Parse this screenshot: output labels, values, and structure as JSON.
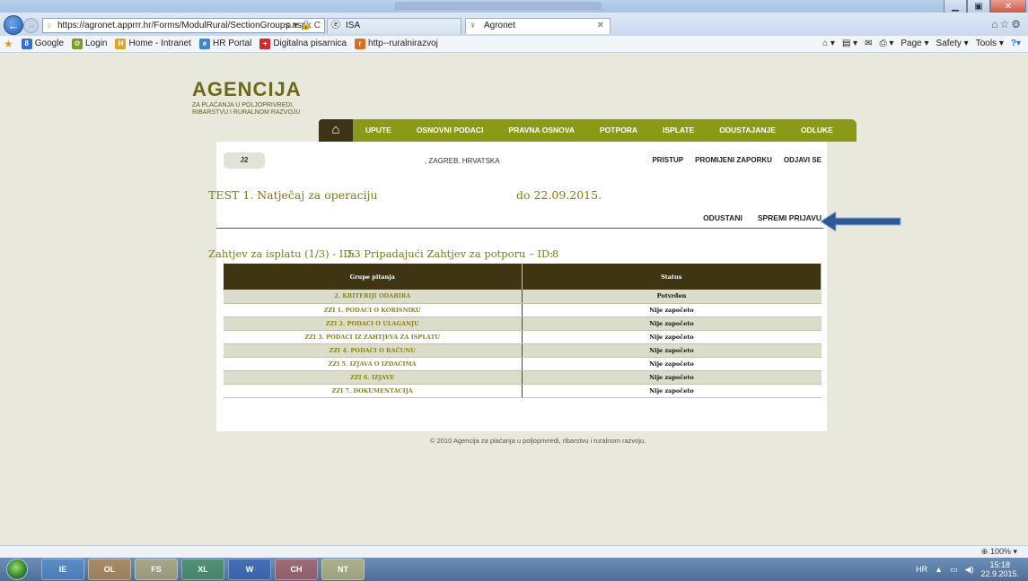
{
  "browser": {
    "url": "https://agronet.apprrr.hr/Forms/ModulRural/SectionGroups.aspx",
    "addr_tools": "ρ ▾ 🔒 C",
    "tabs": [
      {
        "label": "ISA"
      },
      {
        "label": "Agronet"
      }
    ],
    "favorites": [
      {
        "label": "Google",
        "color": "#2f6fd8",
        "glyph": "8"
      },
      {
        "label": "Login",
        "color": "#7a9a2a",
        "glyph": "⚙"
      },
      {
        "label": "Home - Intranet",
        "color": "#e8a21c",
        "glyph": "H"
      },
      {
        "label": "HR Portal",
        "color": "#3a86d4",
        "glyph": "e"
      },
      {
        "label": "Digitalna pisarnica",
        "color": "#d42a2a",
        "glyph": "+"
      },
      {
        "label": "http--ruralnirazvoj",
        "color": "#e46b1a",
        "glyph": "r"
      }
    ],
    "command_bar": [
      "Page ▾",
      "Safety ▾",
      "Tools ▾"
    ],
    "zoom": "100%"
  },
  "site": {
    "logo_big": "AGENCIJA",
    "logo_small": "ZA PLAĆANJA U POLJOPRIVREDI, RIBARSTVU I RURALNOM RAZVOJU",
    "home_icon": "home-icon",
    "menu": [
      "UPUTE",
      "OSNOVNI PODACI",
      "PRAVNA OSNOVA",
      "POTPORA",
      "ISPLATE",
      "ODUSTAJANJE",
      "ODLUKE"
    ]
  },
  "user": {
    "id_fragment": "J2",
    "address": ", ZAGREB, HRVATSKA",
    "links": [
      "PRISTUP",
      "PROMIJENI ZAPORKU",
      "ODJAVI SE"
    ]
  },
  "page": {
    "title": "TEST 1. Natječaj za operaciju",
    "title_date": "do 22.09.2015.",
    "actions": [
      "ODUSTANI",
      "SPREMI PRIJAVU"
    ],
    "zahtjev_part1": "Zahtjev za isplatu (1/3) - ID:",
    "zahtjev_part2": "53 Pripadajući Zahtjev za potporu – ID:",
    "zahtjev_part3": "8",
    "arrow_color": "#2d5a94"
  },
  "table": {
    "headers": [
      "Grupe pitanja",
      "Status"
    ],
    "rows": [
      {
        "group": "2. KRITERIJI ODABIRA",
        "status": "Potvrđen"
      },
      {
        "group": "ZZI 1. PODACI O KORISNIKU",
        "status": "Nije započeto"
      },
      {
        "group": "ZZI 2. PODACI O ULAGANJU",
        "status": "Nije započeto"
      },
      {
        "group": "ZZI 3. PODACI IZ ZAHTJEVA ZA ISPLATU",
        "status": "Nije započeto"
      },
      {
        "group": "ZZI 4. PODACI O RAČUNU",
        "status": "Nije započeto"
      },
      {
        "group": "ZZI 5. IZJAVA O IZDACIMA",
        "status": "Nije započeto"
      },
      {
        "group": "ZZI 6. IZJAVE",
        "status": "Nije započeto"
      },
      {
        "group": "ZZI 7. DOKUMENTACIJA",
        "status": "Nije započeto"
      }
    ]
  },
  "footer": "© 2010 Agencija za plaćanja u poljoprivredi, ribarstvu i ruralnom razvoju.",
  "taskbar": {
    "apps": [
      "IE",
      "OL",
      "FS",
      "XL",
      "W",
      "CH",
      "NT"
    ],
    "lang": "HR",
    "time": "15:18",
    "date": "22.9.2015."
  }
}
